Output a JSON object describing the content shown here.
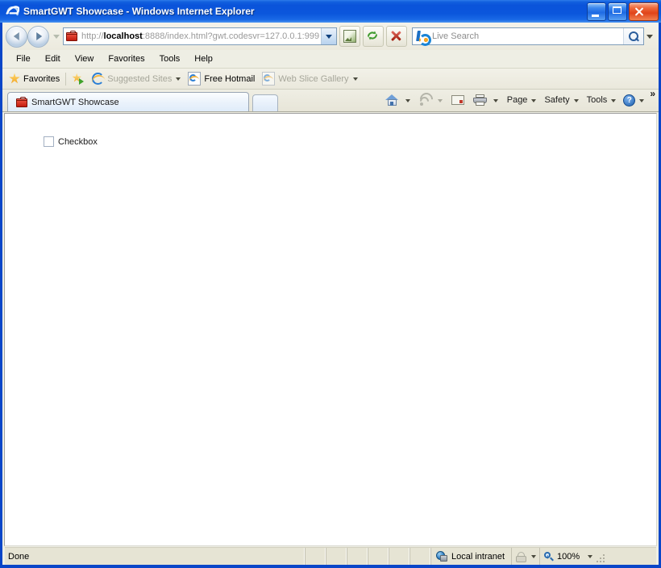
{
  "window": {
    "title": "SmartGWT Showcase - Windows Internet Explorer",
    "app_icon": "ie-logo-icon",
    "controls": {
      "minimize": "minimize-button",
      "maximize": "maximize-button",
      "close": "close-button"
    },
    "frame_color": "#0a46c8",
    "titlebar_color": "#0b56dc"
  },
  "navigation": {
    "back": "Back",
    "forward": "Forward",
    "recent_pages": "Recent Pages",
    "address": {
      "favicon": "toolbox-favicon",
      "url_scheme": "http://",
      "url_host": "localhost",
      "url_rest": ":8888/index.html?gwt.codesvr=127.0.0.1:999",
      "full_url": "http://localhost:8888/index.html?gwt.codesvr=127.0.0.1:999"
    },
    "buttons": {
      "compatibility_view": "Compatibility View",
      "refresh": "Refresh",
      "stop": "Stop"
    },
    "search": {
      "provider_icon": "bing-icon",
      "placeholder": "Live Search",
      "value": "",
      "go": "Search",
      "options": "Search Options"
    }
  },
  "menubar": {
    "items": [
      {
        "label": "File"
      },
      {
        "label": "Edit"
      },
      {
        "label": "View"
      },
      {
        "label": "Favorites"
      },
      {
        "label": "Tools"
      },
      {
        "label": "Help"
      }
    ]
  },
  "favorites_bar": {
    "favorites_button": "Favorites",
    "items": [
      {
        "label": "Suggested Sites",
        "icon": "ie-icon",
        "dimmed": true,
        "has_caret": true
      },
      {
        "label": "Free Hotmail",
        "icon": "ie-document-icon",
        "dimmed": false,
        "has_caret": false
      },
      {
        "label": "Web Slice Gallery",
        "icon": "ie-document-icon",
        "dimmed": true,
        "has_caret": true
      }
    ],
    "add_to_favorites": "Add to Favorites Bar"
  },
  "tabs": {
    "items": [
      {
        "label": "SmartGWT Showcase",
        "icon": "toolbox-favicon",
        "active": true
      }
    ],
    "new_tab": "New Tab"
  },
  "command_bar": {
    "home": "Home",
    "feeds": "Feeds",
    "read_mail": "Read Mail",
    "print": "Print",
    "page": "Page",
    "safety": "Safety",
    "tools": "Tools",
    "help": "?",
    "overflow": "»"
  },
  "page": {
    "checkbox": {
      "label": "Checkbox",
      "checked": false
    }
  },
  "status_bar": {
    "status_text": "Done",
    "zone": "Local intranet",
    "protected_mode": "Protected Mode: Off",
    "zoom": "100%",
    "zoom_options": "Change Zoom Level"
  }
}
